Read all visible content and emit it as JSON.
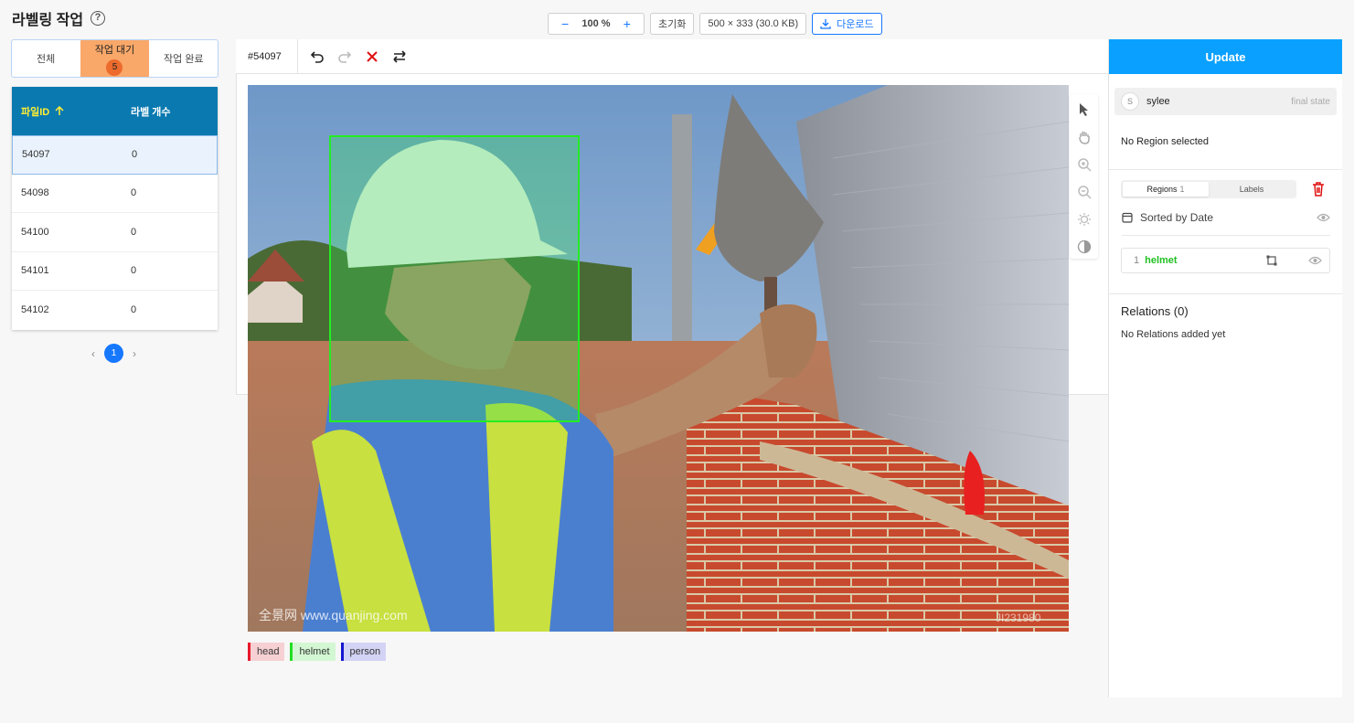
{
  "page": {
    "title": "라벨링 작업",
    "help_icon": "question-circle-icon"
  },
  "top_toolbar": {
    "zoom_out": "−",
    "zoom_value": "100 %",
    "zoom_in": "+",
    "reset_label": "초기화",
    "image_info": "500 × 333 (30.0 KB)",
    "download_label": "다운로드"
  },
  "status_tabs": [
    {
      "label": "전체"
    },
    {
      "label": "작업 대기",
      "count": "5"
    },
    {
      "label": "작업 완료"
    }
  ],
  "file_table": {
    "col_file_id": "파일ID",
    "col_label_count": "라벨 개수",
    "rows": [
      {
        "id": "54097",
        "count": "0"
      },
      {
        "id": "54098",
        "count": "0"
      },
      {
        "id": "54100",
        "count": "0"
      },
      {
        "id": "54101",
        "count": "0"
      },
      {
        "id": "54102",
        "count": "0"
      }
    ]
  },
  "pagination": {
    "prev": "‹",
    "current": "1",
    "next": "›"
  },
  "editor": {
    "task_id": "#54097",
    "watermark_left": "全景网  www.quanjing.com",
    "watermark_right": "JI231980"
  },
  "labels": [
    {
      "name": "head",
      "color": "#e8192c"
    },
    {
      "name": "helmet",
      "color": "#22dd22"
    },
    {
      "name": "person",
      "color": "#1616d0"
    }
  ],
  "right_panel": {
    "update_label": "Update",
    "user_initial": "S",
    "user_name": "sylee",
    "user_state": "final state",
    "no_region_text": "No Region selected",
    "tab_regions": "Regions",
    "tab_regions_count": "1",
    "tab_labels": "Labels",
    "sorted_label": "Sorted by Date",
    "region": {
      "number": "1",
      "label": "helmet"
    },
    "relations_title": "Relations (0)",
    "relations_empty": "No Relations added yet"
  }
}
